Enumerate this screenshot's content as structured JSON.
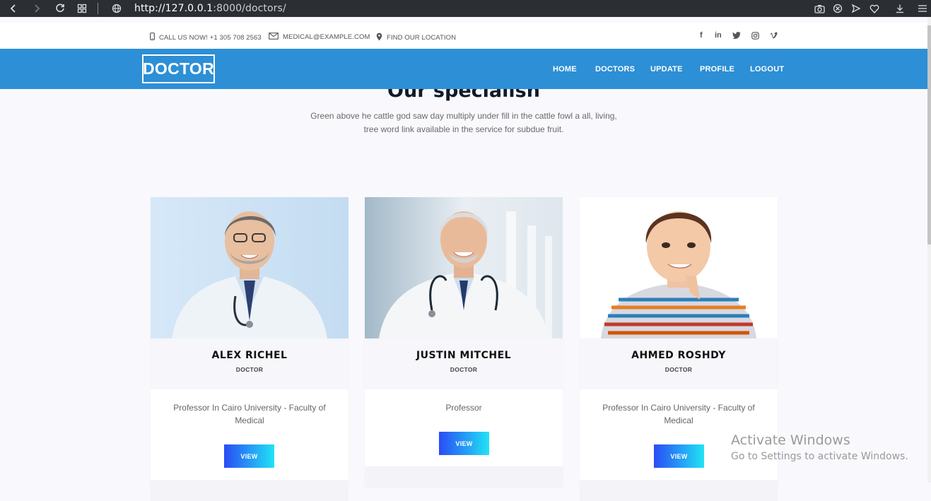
{
  "browser": {
    "url_host": "http://127.0.0.1",
    "url_path": ":8000/doctors/",
    "icons": [
      "back-icon",
      "forward-icon",
      "reload-icon",
      "tabs-grid-icon",
      "globe-icon",
      "camera-icon",
      "shield-icon",
      "send-icon",
      "heart-icon",
      "download-icon",
      "menu-icon"
    ]
  },
  "topbar": {
    "phone": "CALL US NOW! +1 305 708 2563",
    "email": "MEDICAL@EXAMPLE.COM",
    "location": "FIND OUR LOCATION",
    "social": [
      "f",
      "in",
      "t",
      "ig",
      "v"
    ]
  },
  "nav": {
    "logo": "DOCTOR",
    "links": [
      "HOME",
      "DOCTORS",
      "UPDATE",
      "PROFILE",
      "LOGOUT"
    ]
  },
  "section": {
    "title": "Our specialish",
    "subtitle_line1": "Green above he cattle god saw day multiply under fill in the cattle fowl a all, living,",
    "subtitle_line2": "tree word link available in the service for subdue fruit."
  },
  "doctors": [
    {
      "name": "ALEX RICHEL",
      "role": "DOCTOR",
      "desc_line1": "Professor In Cairo University - Faculty of",
      "desc_line2": "Medical",
      "button": "VIEW"
    },
    {
      "name": "JUSTIN MITCHEL",
      "role": "DOCTOR",
      "desc_line1": "Professor",
      "desc_line2": "",
      "button": "VIEW"
    },
    {
      "name": "AHMED ROSHDY",
      "role": "DOCTOR",
      "desc_line1": "Professor In Cairo University - Faculty of",
      "desc_line2": "Medical",
      "button": "VIEW"
    }
  ],
  "watermark": {
    "line1": "Activate Windows",
    "line2": "Go to Settings to activate Windows."
  },
  "colors": {
    "nav_bg": "#2d8fd5",
    "button_gradient_start": "#2a4cf5",
    "button_gradient_end": "#21e3f5",
    "page_bg": "#f9f9fd"
  }
}
